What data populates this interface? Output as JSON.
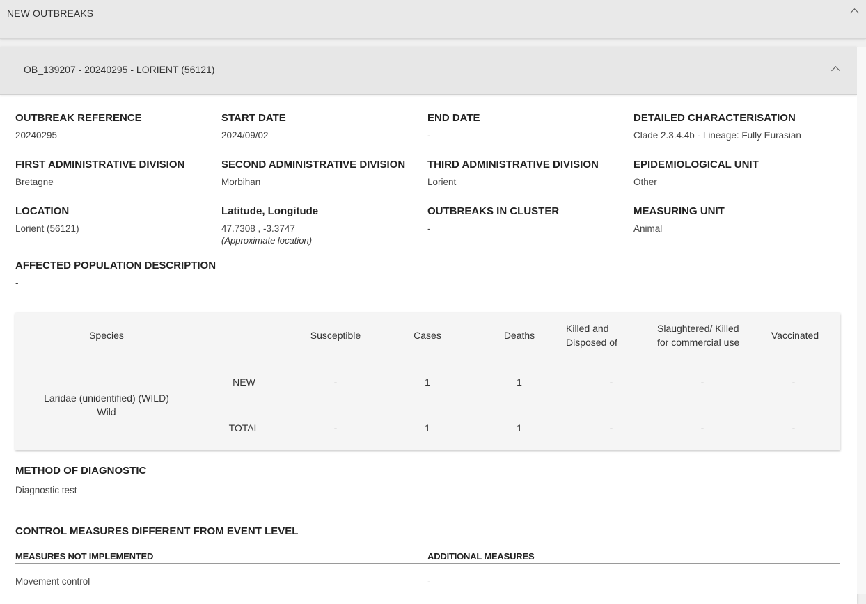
{
  "top_panel": {
    "title": "NEW OUTBREAKS"
  },
  "outbreak_panel": {
    "title": "OB_139207 - 20240295 - LORIENT (56121)"
  },
  "fields": {
    "outbreak_reference": {
      "label": "OUTBREAK REFERENCE",
      "value": "20240295"
    },
    "start_date": {
      "label": "START DATE",
      "value": "2024/09/02"
    },
    "end_date": {
      "label": "END DATE",
      "value": "-"
    },
    "detailed_characterisation": {
      "label": "DETAILED CHARACTERISATION",
      "value": "Clade 2.3.4.4b - Lineage: Fully Eurasian"
    },
    "first_admin_division": {
      "label": "FIRST ADMINISTRATIVE DIVISION",
      "value": "Bretagne"
    },
    "second_admin_division": {
      "label": "SECOND ADMINISTRATIVE DIVISION",
      "value": "Morbihan"
    },
    "third_admin_division": {
      "label": "THIRD ADMINISTRATIVE DIVISION",
      "value": "Lorient"
    },
    "epidemiological_unit": {
      "label": "EPIDEMIOLOGICAL UNIT",
      "value": "Other"
    },
    "location": {
      "label": "LOCATION",
      "value": "Lorient (56121)"
    },
    "lat_long": {
      "label": "Latitude, Longitude",
      "value": "47.7308 , -3.3747",
      "note": "(Approximate location)"
    },
    "outbreaks_in_cluster": {
      "label": "OUTBREAKS IN CLUSTER",
      "value": "-"
    },
    "measuring_unit": {
      "label": "MEASURING UNIT",
      "value": "Animal"
    },
    "affected_population": {
      "label": "AFFECTED POPULATION DESCRIPTION",
      "value": "-"
    }
  },
  "species_table": {
    "headers": {
      "species": "Species",
      "susceptible": "Susceptible",
      "cases": "Cases",
      "deaths": "Deaths",
      "killed_disposed": "Killed and Disposed of",
      "slaughtered": "Slaughtered/ Killed for commercial use",
      "vaccinated": "Vaccinated"
    },
    "species_name": "Laridae (unidentified) (WILD)",
    "species_type": "Wild",
    "rows": [
      {
        "label": "NEW",
        "susceptible": "-",
        "cases": "1",
        "deaths": "1",
        "killed_disposed": "-",
        "slaughtered": "-",
        "vaccinated": "-"
      },
      {
        "label": "TOTAL",
        "susceptible": "-",
        "cases": "1",
        "deaths": "1",
        "killed_disposed": "-",
        "slaughtered": "-",
        "vaccinated": "-"
      }
    ]
  },
  "diagnostic": {
    "label": "METHOD OF DIAGNOSTIC",
    "value": "Diagnostic test"
  },
  "control_measures": {
    "title": "CONTROL MEASURES DIFFERENT FROM EVENT LEVEL",
    "not_implemented_label": "MEASURES NOT IMPLEMENTED",
    "additional_label": "ADDITIONAL MEASURES",
    "not_implemented_value": "Movement control",
    "additional_value": "-"
  },
  "icons": {
    "collapse": "chevron-up-icon"
  }
}
